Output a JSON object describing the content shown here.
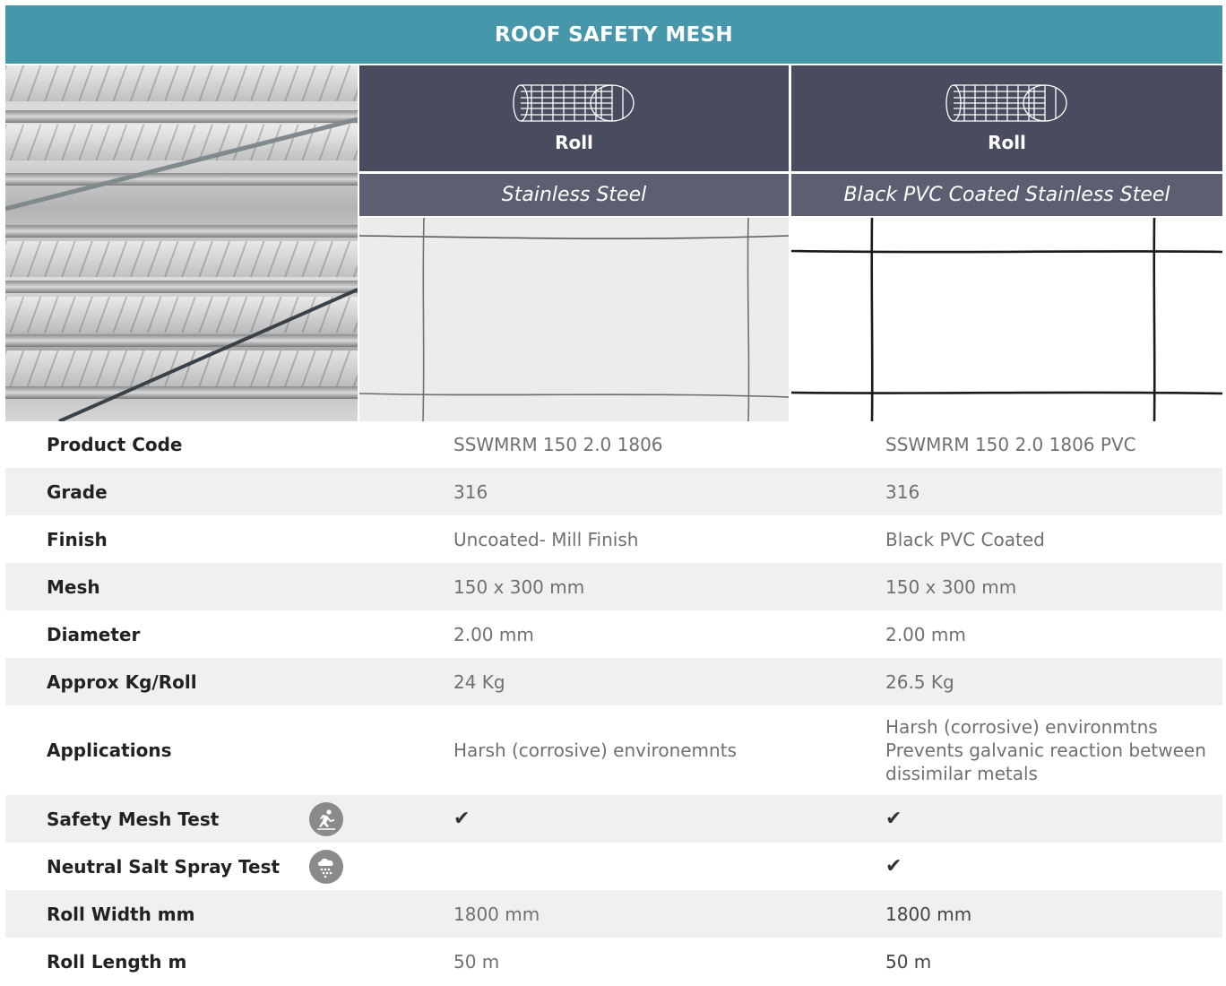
{
  "title": "ROOF SAFETY MESH",
  "columns": [
    {
      "form_icon": "roll-mesh-icon",
      "form_label": "Roll",
      "material": "Stainless Steel"
    },
    {
      "form_icon": "roll-mesh-icon",
      "form_label": "Roll",
      "material": "Black PVC Coated Stainless Steel"
    }
  ],
  "rows": [
    {
      "label": "Product Code",
      "values": [
        "SSWMRM 150 2.0 1806",
        "SSWMRM 150 2.0 1806 PVC"
      ]
    },
    {
      "label": "Grade",
      "values": [
        "316",
        "316"
      ]
    },
    {
      "label": "Finish",
      "values": [
        "Uncoated- Mill Finish",
        "Black PVC Coated"
      ]
    },
    {
      "label": "Mesh",
      "values": [
        "150 x 300 mm",
        "150 x 300 mm"
      ]
    },
    {
      "label": "Diameter",
      "values": [
        "2.00 mm",
        "2.00 mm"
      ]
    },
    {
      "label": "Approx Kg/Roll",
      "values": [
        "24 Kg",
        "26.5 Kg"
      ]
    },
    {
      "label": "Applications",
      "values": [
        "Harsh (corrosive) environemnts",
        [
          "Harsh (corrosive) environmtns",
          "Prevents galvanic reaction between dissimilar metals"
        ]
      ]
    },
    {
      "label": "Safety Mesh Test",
      "icon": "falling-person-icon",
      "values": [
        "✔",
        "✔"
      ]
    },
    {
      "label": "Neutral Salt Spray Test",
      "icon": "salt-spray-icon",
      "values": [
        "",
        "✔"
      ]
    },
    {
      "label": "Roll Width mm",
      "values": [
        "1800 mm",
        "1800 mm"
      ]
    },
    {
      "label": "Roll Length m",
      "values": [
        "50 m",
        "50 m"
      ]
    }
  ],
  "colors": {
    "banner": "#4797ab",
    "header_dark": "#484c5e",
    "header_material": "#5b5f71",
    "row_alt": "#f0f0f0"
  }
}
